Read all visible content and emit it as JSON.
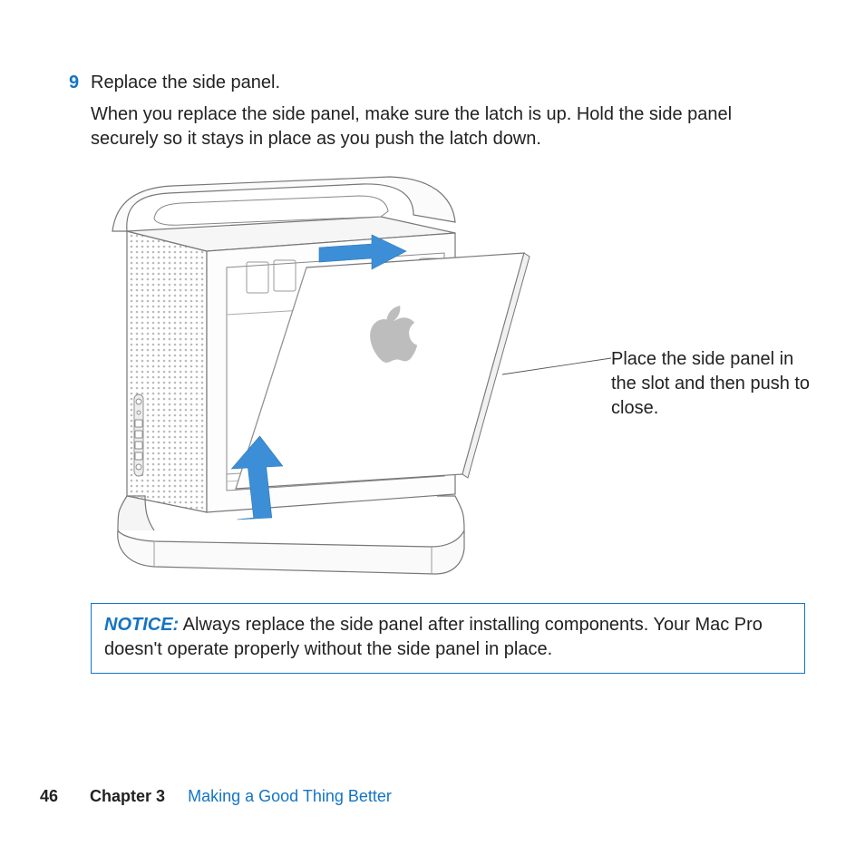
{
  "step": {
    "number": "9",
    "title": "Replace the side panel.",
    "body": "When you replace the side panel, make sure the latch is up. Hold the side panel securely so it stays in place as you push the latch down."
  },
  "callout": {
    "text": "Place the side panel in the slot and then push to close."
  },
  "notice": {
    "label": "NOTICE:",
    "text": "  Always replace the side panel after installing components. Your Mac Pro doesn't operate properly without the side panel in place."
  },
  "footer": {
    "page_number": "46",
    "chapter_label": "Chapter 3",
    "chapter_title": "Making a Good Thing Better"
  }
}
